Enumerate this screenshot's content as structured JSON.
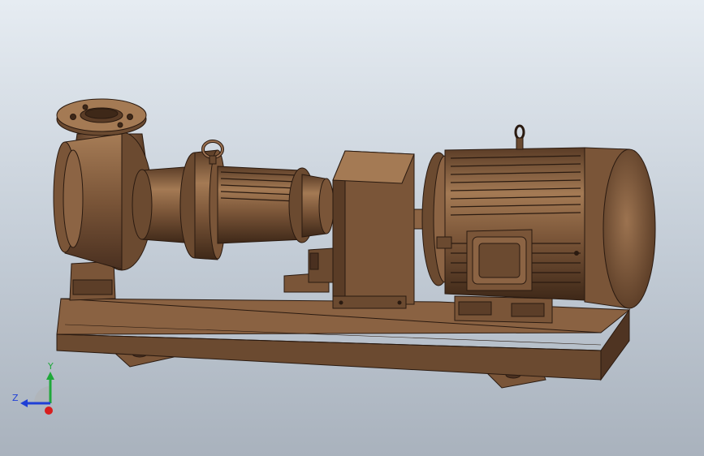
{
  "viewport": {
    "background_top": "#e6ecf2",
    "background_bottom": "#a9b2bd"
  },
  "model": {
    "color_base": "#7a5538",
    "color_light": "#a67c56",
    "color_dark": "#4a3020",
    "edge_color": "#2a1a10"
  },
  "triad": {
    "y_label": "Y",
    "z_label": "Z",
    "y_color": "#1fa83a",
    "z_color": "#1f3fd6",
    "x_color": "#d81e1e"
  }
}
